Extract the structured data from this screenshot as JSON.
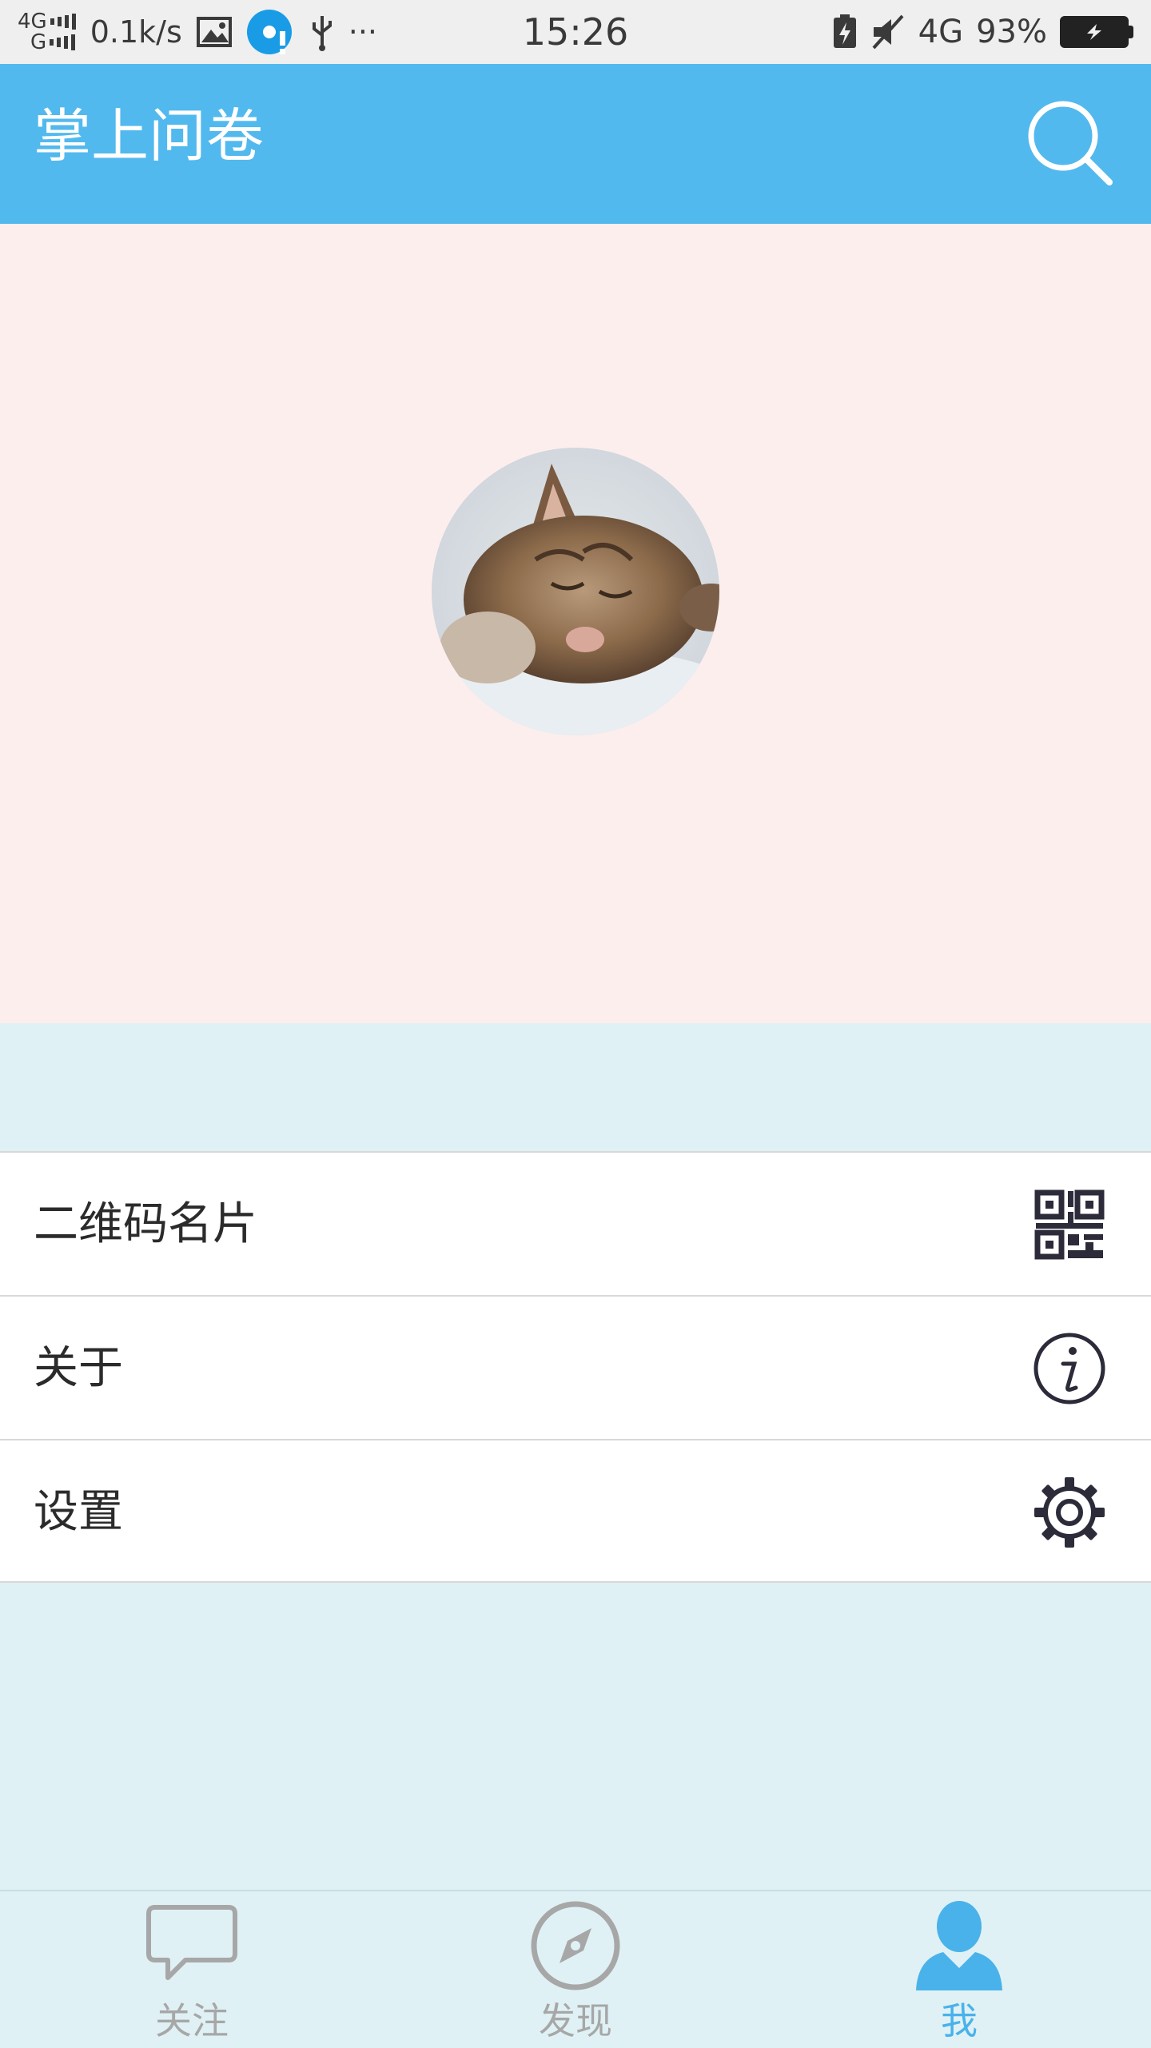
{
  "status_bar": {
    "network_top": "4G",
    "network_bottom": "G",
    "speed": "0.1k/s",
    "more": "···",
    "time": "15:26",
    "network_right": "4G",
    "battery": "93%"
  },
  "app_bar": {
    "title": "掌上问卷",
    "color": "#52b9ee",
    "search_icon": "search-icon"
  },
  "profile": {
    "background": "#fdeeee",
    "avatar": "kitten-avatar"
  },
  "menu": {
    "items": [
      {
        "label": "二维码名片",
        "icon": "qr-code-icon"
      },
      {
        "label": "关于",
        "icon": "info-icon"
      },
      {
        "label": "设置",
        "icon": "gear-icon"
      }
    ]
  },
  "bottom_nav": {
    "tabs": [
      {
        "label": "关注",
        "icon": "chat-bubble-icon",
        "active": false
      },
      {
        "label": "发现",
        "icon": "compass-icon",
        "active": false
      },
      {
        "label": "我",
        "icon": "person-icon",
        "active": true
      }
    ],
    "active_color": "#49b2ea",
    "inactive_color": "#a7a7a7"
  }
}
